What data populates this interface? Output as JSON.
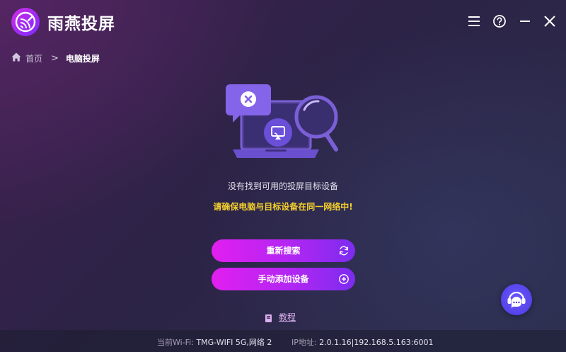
{
  "app": {
    "title": "雨燕投屏"
  },
  "breadcrumb": {
    "home": "首页",
    "separator": ">",
    "current": "电脑投屏"
  },
  "icons": {
    "logo": "cast-logo-icon",
    "menu": "menu-icon",
    "help": "help-icon",
    "minimize": "minimize-icon",
    "close": "close-icon",
    "home": "home-icon",
    "illustration": "no-device-search-illustration",
    "refresh": "refresh-icon",
    "add": "add-circle-icon",
    "tutorial": "book-icon",
    "chat": "customer-service-icon"
  },
  "main": {
    "message": "没有找到可用的投屏目标设备",
    "warning": "请确保电脑与目标设备在同一网络中!",
    "search_button": "重新搜索",
    "add_button": "手动添加设备",
    "tutorial_link": "教程"
  },
  "status": {
    "wifi_label": "当前Wi-Fi:",
    "wifi_value": "TMG-WIFI 5G,网络 2",
    "ip_label": "IP地址:",
    "ip_value": "2.0.1.16|192.168.5.163:6001"
  },
  "colors": {
    "accent_gradient_start": "#e11ff0",
    "accent_gradient_end": "#7c2cf0",
    "warning": "#f3cf2c",
    "chat_button": "#5a46f0"
  }
}
